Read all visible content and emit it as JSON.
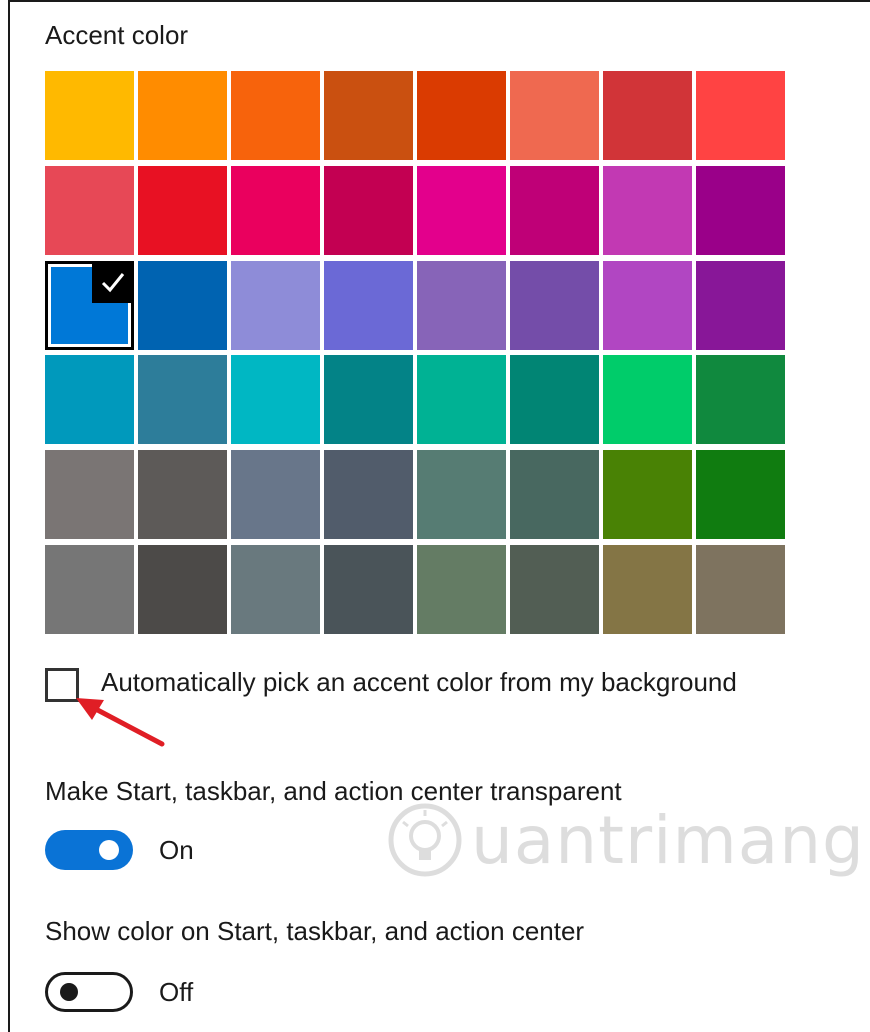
{
  "accent_section": {
    "title": "Accent color",
    "selected_index": 16,
    "swatches": [
      "#ffb900",
      "#ff8c00",
      "#f7630c",
      "#ca5010",
      "#da3b01",
      "#ef6950",
      "#d13438",
      "#ff4343",
      "#e74856",
      "#e81123",
      "#ea005e",
      "#c30052",
      "#e3008c",
      "#bf0077",
      "#c239b3",
      "#9a0089",
      "#0078d7",
      "#0063b1",
      "#8e8cd8",
      "#6b69d6",
      "#8764b8",
      "#744da9",
      "#b146c2",
      "#881798",
      "#0099bc",
      "#2d7d9a",
      "#00b7c3",
      "#038387",
      "#00b294",
      "#018574",
      "#00cc6a",
      "#10893e",
      "#7a7574",
      "#5d5a58",
      "#68768a",
      "#515c6b",
      "#567c73",
      "#486860",
      "#498205",
      "#107c10",
      "#767676",
      "#4c4a48",
      "#69797e",
      "#4a5459",
      "#647c64",
      "#525e54",
      "#847545",
      "#7e735f"
    ]
  },
  "auto_pick": {
    "label": "Automatically pick an accent color from my background",
    "checked": false,
    "checkbox_icon": "checkbox-empty-icon",
    "arrow_color": "#e01e25"
  },
  "transparency": {
    "label": "Make Start, taskbar, and action center transparent",
    "state": "On",
    "on": true,
    "accent": "#0a73d6"
  },
  "show_color": {
    "label": "Show color on Start, taskbar, and action center",
    "state": "Off",
    "on": false
  },
  "watermark": {
    "icon": "lightbulb-icon",
    "text": "uantrimang"
  }
}
